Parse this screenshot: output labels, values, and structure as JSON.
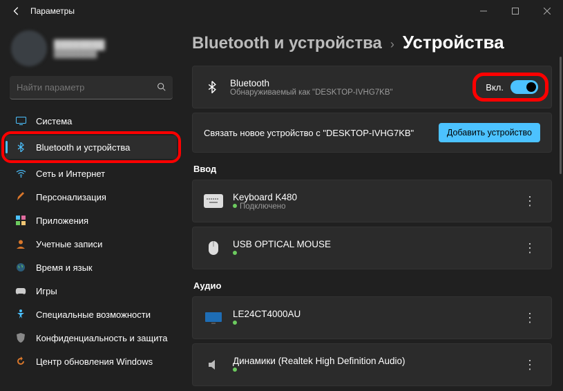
{
  "window": {
    "title": "Параметры"
  },
  "profile": {
    "name": "████████",
    "email": "████████"
  },
  "search": {
    "placeholder": "Найти параметр"
  },
  "sidebar": {
    "items": [
      {
        "icon": "system",
        "label": "Система"
      },
      {
        "icon": "bt",
        "label": "Bluetooth и устройства",
        "active": true
      },
      {
        "icon": "wifi",
        "label": "Сеть и Интернет"
      },
      {
        "icon": "brush",
        "label": "Персонализация"
      },
      {
        "icon": "apps",
        "label": "Приложения"
      },
      {
        "icon": "account",
        "label": "Учетные записи"
      },
      {
        "icon": "time",
        "label": "Время и язык"
      },
      {
        "icon": "gaming",
        "label": "Игры"
      },
      {
        "icon": "access",
        "label": "Специальные возможности"
      },
      {
        "icon": "privacy",
        "label": "Конфиденциальность и защита"
      },
      {
        "icon": "update",
        "label": "Центр обновления Windows"
      }
    ]
  },
  "breadcrumb": {
    "parent": "Bluetooth и устройства",
    "current": "Устройства"
  },
  "bluetooth_card": {
    "title": "Bluetooth",
    "subtitle": "Обнаруживаемый как \"DESKTOP-IVHG7KB\"",
    "toggle_label": "Вкл.",
    "toggle_on": true
  },
  "pair_card": {
    "text": "Связать новое устройство с \"DESKTOP-IVHG7KB\"",
    "button": "Добавить устройство"
  },
  "sections": {
    "input": {
      "label": "Ввод",
      "devices": [
        {
          "type": "keyboard",
          "name": "Keyboard K480",
          "status": "Подключено"
        },
        {
          "type": "mouse",
          "name": "USB OPTICAL MOUSE",
          "status": ""
        }
      ]
    },
    "audio": {
      "label": "Аудио",
      "devices": [
        {
          "type": "monitor",
          "name": "LE24CT4000AU",
          "status": ""
        },
        {
          "type": "speaker",
          "name": "Динамики (Realtek High Definition Audio)",
          "status": ""
        }
      ]
    }
  }
}
